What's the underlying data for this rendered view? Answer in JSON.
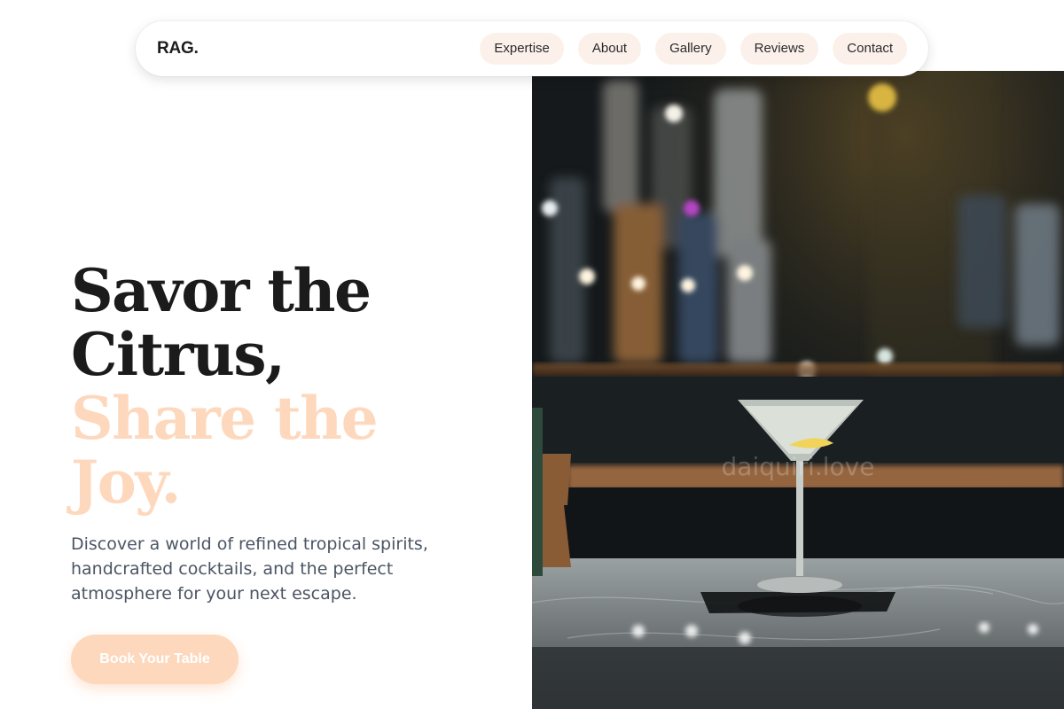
{
  "brand": {
    "logo": "RAG."
  },
  "nav": {
    "items": [
      {
        "label": "Expertise"
      },
      {
        "label": "About"
      },
      {
        "label": "Gallery"
      },
      {
        "label": "Reviews"
      },
      {
        "label": "Contact"
      }
    ]
  },
  "hero": {
    "headline_line1": "Savor the",
    "headline_line2": "Citrus,",
    "headline_line3": "Share the",
    "headline_line4": "Joy.",
    "description": "Discover a world of refined tropical spirits, handcrafted cocktails, and the perfect atmosphere for your next escape.",
    "cta_label": "Book Your Table",
    "image_watermark": "daiquiri.love"
  },
  "colors": {
    "accent": "#fdd8bd",
    "nav_pill": "#fbf1ea",
    "text_dark": "#1b1b1b",
    "text_muted": "#4b5563"
  }
}
